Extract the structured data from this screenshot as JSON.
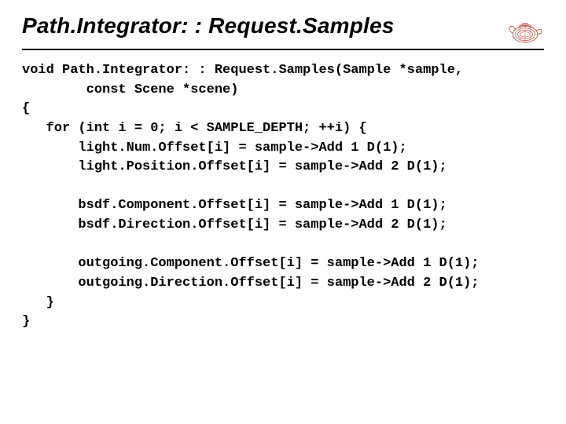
{
  "title": "Path.Integrator: : Request.Samples",
  "code_lines": [
    "void Path.Integrator: : Request.Samples(Sample *sample,",
    "        const Scene *scene)",
    "{",
    "   for (int i = 0; i < SAMPLE_DEPTH; ++i) {",
    "       light.Num.Offset[i] = sample->Add 1 D(1);",
    "       light.Position.Offset[i] = sample->Add 2 D(1);",
    "",
    "       bsdf.Component.Offset[i] = sample->Add 1 D(1);",
    "       bsdf.Direction.Offset[i] = sample->Add 2 D(1);",
    "",
    "       outgoing.Component.Offset[i] = sample->Add 1 D(1);",
    "       outgoing.Direction.Offset[i] = sample->Add 2 D(1);",
    "   }",
    "}"
  ]
}
